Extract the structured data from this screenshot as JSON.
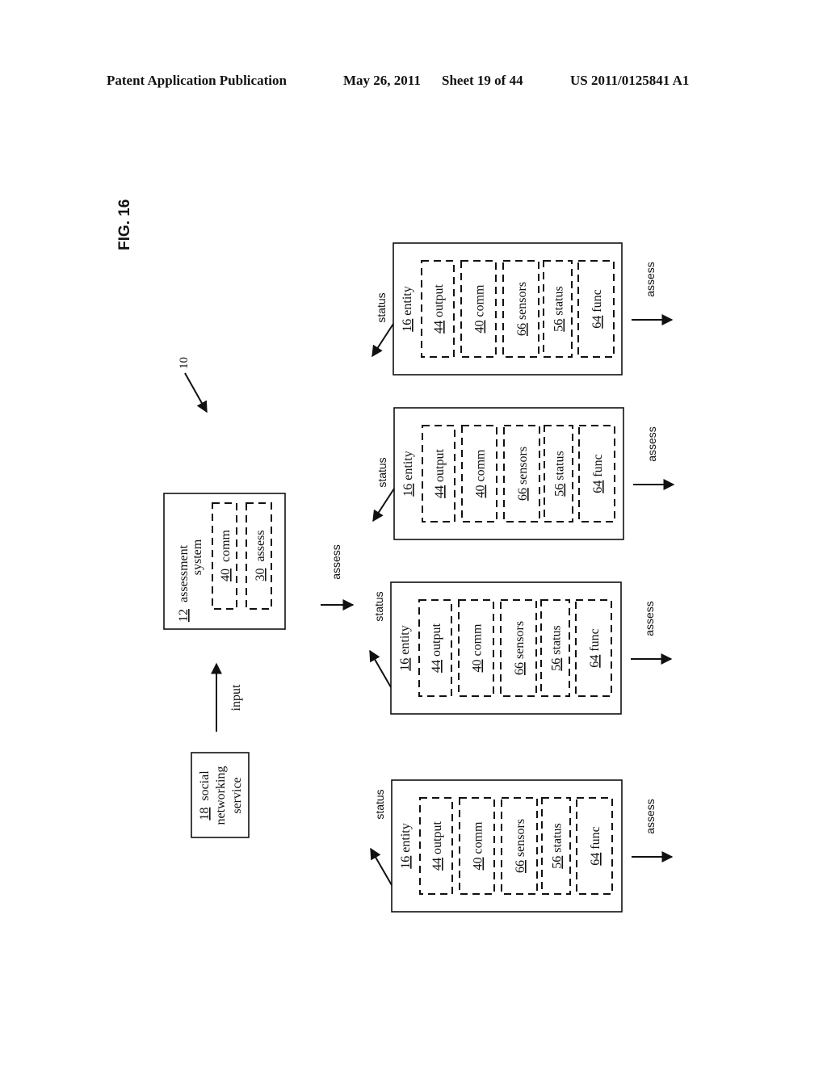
{
  "header": {
    "publication": "Patent Application Publication",
    "date": "May 26, 2011",
    "sheet": "Sheet 19 of 44",
    "number": "US 2011/0125841 A1"
  },
  "figure": {
    "label": "FIG. 16",
    "system_ref": "10"
  },
  "assessment_system": {
    "ref": "12",
    "line1": "assessment",
    "line2": "system",
    "modules": [
      {
        "ref": "40",
        "label": "comm"
      },
      {
        "ref": "30",
        "label": "assess"
      }
    ]
  },
  "social_networking_service": {
    "ref": "18",
    "line1": "social",
    "line2": "networking",
    "line3": "service"
  },
  "arrows": {
    "input": "input",
    "assess": "assess",
    "status": "status"
  },
  "entities": [
    {
      "ref": "16",
      "label": "entity",
      "modules": [
        {
          "ref": "44",
          "label": "output"
        },
        {
          "ref": "40",
          "label": "comm"
        },
        {
          "ref": "66",
          "label": "sensors"
        },
        {
          "ref": "56",
          "label": "status"
        },
        {
          "ref": "64",
          "label": "func"
        }
      ]
    },
    {
      "ref": "16",
      "label": "entity",
      "modules": [
        {
          "ref": "44",
          "label": "output"
        },
        {
          "ref": "40",
          "label": "comm"
        },
        {
          "ref": "66",
          "label": "sensors"
        },
        {
          "ref": "56",
          "label": "status"
        },
        {
          "ref": "64",
          "label": "func"
        }
      ]
    },
    {
      "ref": "16",
      "label": "entity",
      "modules": [
        {
          "ref": "44",
          "label": "output"
        },
        {
          "ref": "40",
          "label": "comm"
        },
        {
          "ref": "66",
          "label": "sensors"
        },
        {
          "ref": "56",
          "label": "status"
        },
        {
          "ref": "64",
          "label": "func"
        }
      ]
    },
    {
      "ref": "16",
      "label": "entity",
      "modules": [
        {
          "ref": "44",
          "label": "output"
        },
        {
          "ref": "40",
          "label": "comm"
        },
        {
          "ref": "66",
          "label": "sensors"
        },
        {
          "ref": "56",
          "label": "status"
        },
        {
          "ref": "64",
          "label": "func"
        }
      ]
    }
  ]
}
